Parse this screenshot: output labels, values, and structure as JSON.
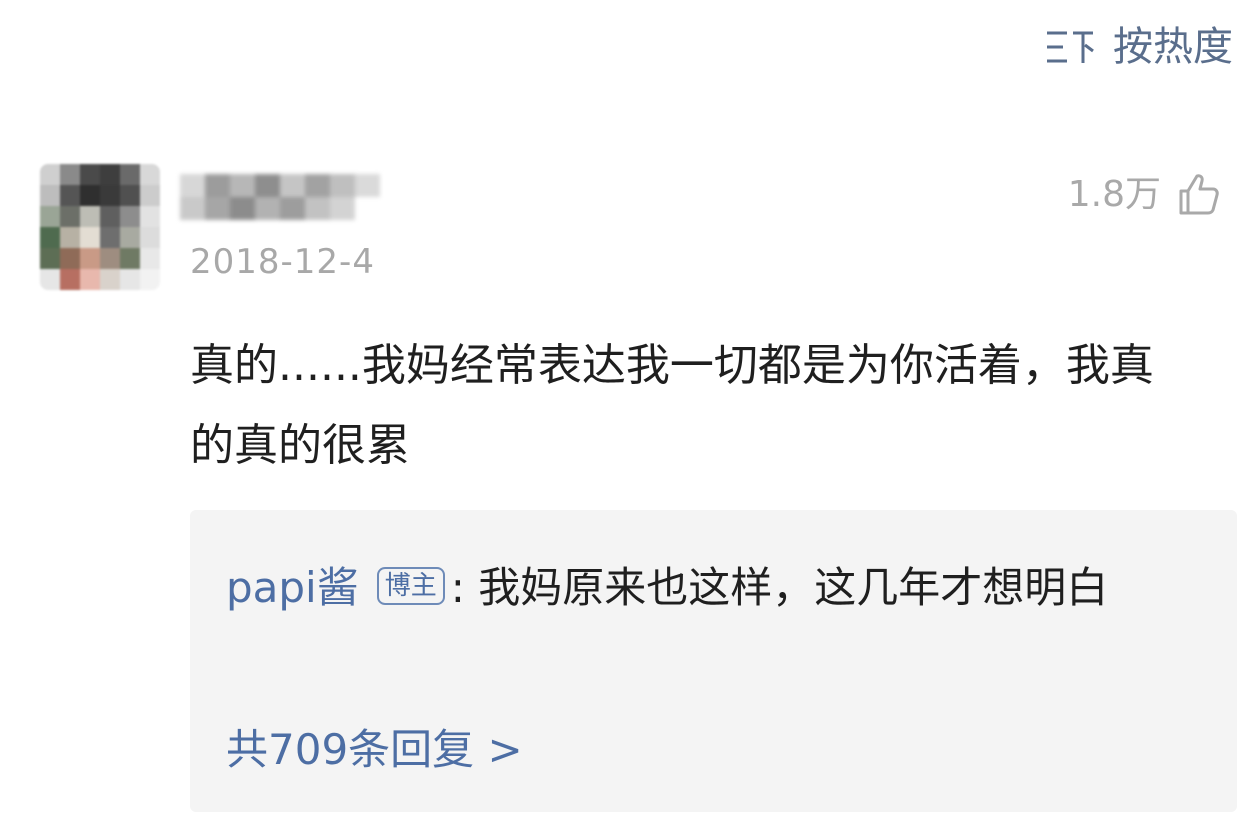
{
  "sort": {
    "icon": "sort-icon",
    "label": "按热度"
  },
  "comment": {
    "avatar_icon": "pixelated-avatar",
    "date": "2018-12-4",
    "likes": "1.8万",
    "like_icon": "thumbs-up-icon",
    "text": "真的......我妈经常表达我一切都是为你活着，我真的真的很累"
  },
  "reply": {
    "author": "papi酱",
    "badge": "博主",
    "separator": ":",
    "text": "我妈原来也这样，这几年才想明白",
    "count_link": "共709条回复 >"
  },
  "colors": {
    "link": "#4d6ea4",
    "meta": "#a8a8a8",
    "text": "#1f1f1f",
    "reply_bg": "#f4f4f4"
  }
}
